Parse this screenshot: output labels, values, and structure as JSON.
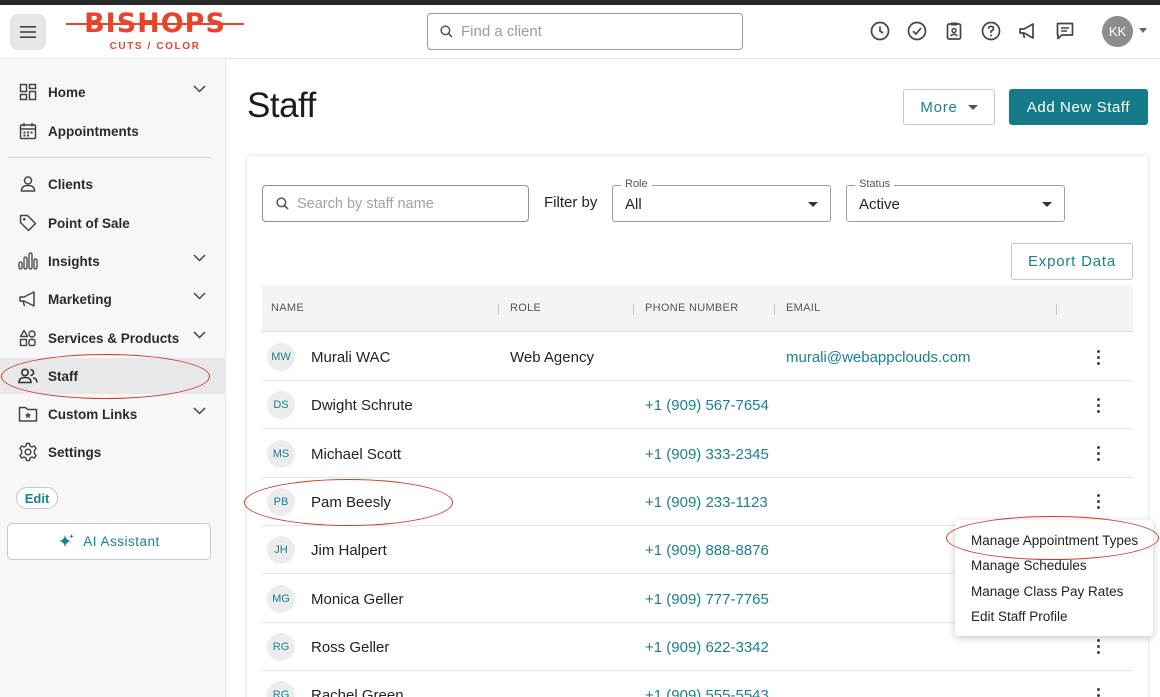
{
  "header": {
    "logo_text": "BISHOPS",
    "logo_subtitle": "CUTS / COLOR",
    "search_placeholder": "Find a client",
    "user_initials": "KK"
  },
  "sidebar": {
    "items": [
      {
        "label": "Home",
        "icon": "home-grid-icon"
      },
      {
        "label": "Appointments",
        "icon": "calendar-icon"
      },
      {
        "label": "Clients",
        "icon": "person-icon"
      },
      {
        "label": "Point of Sale",
        "icon": "tag-icon"
      },
      {
        "label": "Insights",
        "icon": "bar-chart-icon"
      },
      {
        "label": "Marketing",
        "icon": "megaphone-icon"
      },
      {
        "label": "Services & Products",
        "icon": "shapes-icon"
      },
      {
        "label": "Staff",
        "icon": "people-icon"
      },
      {
        "label": "Custom Links",
        "icon": "star-folder-icon"
      },
      {
        "label": "Settings",
        "icon": "gear-icon"
      }
    ],
    "edit_label": "Edit",
    "ai_label": "AI Assistant"
  },
  "main": {
    "title": "Staff",
    "more_label": "More",
    "add_label": "Add New Staff",
    "search_placeholder": "Search by staff name",
    "filter_label": "Filter by",
    "role_label": "Role",
    "role_value": "All",
    "status_label": "Status",
    "status_value": "Active",
    "export_label": "Export Data"
  },
  "table": {
    "columns": [
      "NAME",
      "ROLE",
      "PHONE NUMBER",
      "EMAIL"
    ],
    "rows": [
      {
        "initials": "MW",
        "name": "Murali WAC",
        "role": "Web Agency",
        "phone": "",
        "email": "murali@webappclouds.com"
      },
      {
        "initials": "DS",
        "name": "Dwight Schrute",
        "role": "",
        "phone": "+1 (909) 567-7654",
        "email": ""
      },
      {
        "initials": "MS",
        "name": "Michael Scott",
        "role": "",
        "phone": "+1 (909) 333-2345",
        "email": ""
      },
      {
        "initials": "PB",
        "name": "Pam Beesly",
        "role": "",
        "phone": "+1 (909) 233-1123",
        "email": ""
      },
      {
        "initials": "JH",
        "name": "Jim Halpert",
        "role": "",
        "phone": "+1 (909) 888-8876",
        "email": ""
      },
      {
        "initials": "MG",
        "name": "Monica Geller",
        "role": "",
        "phone": "+1 (909) 777-7765",
        "email": ""
      },
      {
        "initials": "RG",
        "name": "Ross Geller",
        "role": "",
        "phone": "+1 (909) 622-3342",
        "email": ""
      },
      {
        "initials": "RG",
        "name": "Rachel Green",
        "role": "",
        "phone": "+1 (909) 555-5543",
        "email": ""
      }
    ]
  },
  "context_menu": {
    "items": [
      "Manage Appointment Types",
      "Manage Schedules",
      "Manage Class Pay Rates",
      "Edit Staff Profile"
    ]
  },
  "colors": {
    "accent": "#167b89",
    "brand": "#e8442a",
    "annotation": "#d2392b"
  }
}
